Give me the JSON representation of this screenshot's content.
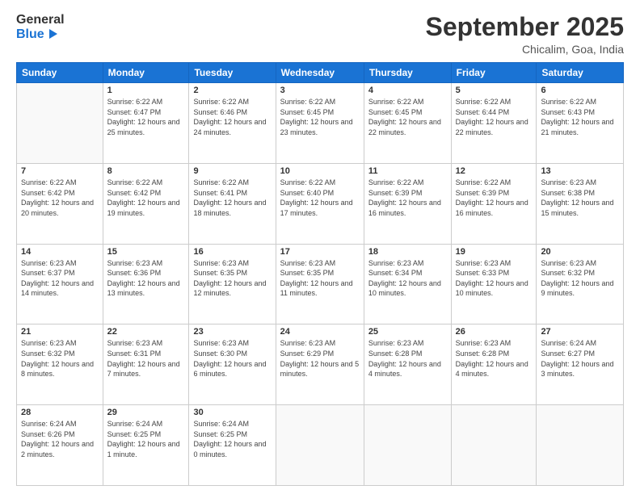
{
  "logo": {
    "line1": "General",
    "line2": "Blue"
  },
  "title": "September 2025",
  "location": "Chicalim, Goa, India",
  "weekdays": [
    "Sunday",
    "Monday",
    "Tuesday",
    "Wednesday",
    "Thursday",
    "Friday",
    "Saturday"
  ],
  "weeks": [
    [
      {
        "day": "",
        "sunrise": "",
        "sunset": "",
        "daylight": ""
      },
      {
        "day": "1",
        "sunrise": "Sunrise: 6:22 AM",
        "sunset": "Sunset: 6:47 PM",
        "daylight": "Daylight: 12 hours and 25 minutes."
      },
      {
        "day": "2",
        "sunrise": "Sunrise: 6:22 AM",
        "sunset": "Sunset: 6:46 PM",
        "daylight": "Daylight: 12 hours and 24 minutes."
      },
      {
        "day": "3",
        "sunrise": "Sunrise: 6:22 AM",
        "sunset": "Sunset: 6:45 PM",
        "daylight": "Daylight: 12 hours and 23 minutes."
      },
      {
        "day": "4",
        "sunrise": "Sunrise: 6:22 AM",
        "sunset": "Sunset: 6:45 PM",
        "daylight": "Daylight: 12 hours and 22 minutes."
      },
      {
        "day": "5",
        "sunrise": "Sunrise: 6:22 AM",
        "sunset": "Sunset: 6:44 PM",
        "daylight": "Daylight: 12 hours and 22 minutes."
      },
      {
        "day": "6",
        "sunrise": "Sunrise: 6:22 AM",
        "sunset": "Sunset: 6:43 PM",
        "daylight": "Daylight: 12 hours and 21 minutes."
      }
    ],
    [
      {
        "day": "7",
        "sunrise": "Sunrise: 6:22 AM",
        "sunset": "Sunset: 6:42 PM",
        "daylight": "Daylight: 12 hours and 20 minutes."
      },
      {
        "day": "8",
        "sunrise": "Sunrise: 6:22 AM",
        "sunset": "Sunset: 6:42 PM",
        "daylight": "Daylight: 12 hours and 19 minutes."
      },
      {
        "day": "9",
        "sunrise": "Sunrise: 6:22 AM",
        "sunset": "Sunset: 6:41 PM",
        "daylight": "Daylight: 12 hours and 18 minutes."
      },
      {
        "day": "10",
        "sunrise": "Sunrise: 6:22 AM",
        "sunset": "Sunset: 6:40 PM",
        "daylight": "Daylight: 12 hours and 17 minutes."
      },
      {
        "day": "11",
        "sunrise": "Sunrise: 6:22 AM",
        "sunset": "Sunset: 6:39 PM",
        "daylight": "Daylight: 12 hours and 16 minutes."
      },
      {
        "day": "12",
        "sunrise": "Sunrise: 6:22 AM",
        "sunset": "Sunset: 6:39 PM",
        "daylight": "Daylight: 12 hours and 16 minutes."
      },
      {
        "day": "13",
        "sunrise": "Sunrise: 6:23 AM",
        "sunset": "Sunset: 6:38 PM",
        "daylight": "Daylight: 12 hours and 15 minutes."
      }
    ],
    [
      {
        "day": "14",
        "sunrise": "Sunrise: 6:23 AM",
        "sunset": "Sunset: 6:37 PM",
        "daylight": "Daylight: 12 hours and 14 minutes."
      },
      {
        "day": "15",
        "sunrise": "Sunrise: 6:23 AM",
        "sunset": "Sunset: 6:36 PM",
        "daylight": "Daylight: 12 hours and 13 minutes."
      },
      {
        "day": "16",
        "sunrise": "Sunrise: 6:23 AM",
        "sunset": "Sunset: 6:35 PM",
        "daylight": "Daylight: 12 hours and 12 minutes."
      },
      {
        "day": "17",
        "sunrise": "Sunrise: 6:23 AM",
        "sunset": "Sunset: 6:35 PM",
        "daylight": "Daylight: 12 hours and 11 minutes."
      },
      {
        "day": "18",
        "sunrise": "Sunrise: 6:23 AM",
        "sunset": "Sunset: 6:34 PM",
        "daylight": "Daylight: 12 hours and 10 minutes."
      },
      {
        "day": "19",
        "sunrise": "Sunrise: 6:23 AM",
        "sunset": "Sunset: 6:33 PM",
        "daylight": "Daylight: 12 hours and 10 minutes."
      },
      {
        "day": "20",
        "sunrise": "Sunrise: 6:23 AM",
        "sunset": "Sunset: 6:32 PM",
        "daylight": "Daylight: 12 hours and 9 minutes."
      }
    ],
    [
      {
        "day": "21",
        "sunrise": "Sunrise: 6:23 AM",
        "sunset": "Sunset: 6:32 PM",
        "daylight": "Daylight: 12 hours and 8 minutes."
      },
      {
        "day": "22",
        "sunrise": "Sunrise: 6:23 AM",
        "sunset": "Sunset: 6:31 PM",
        "daylight": "Daylight: 12 hours and 7 minutes."
      },
      {
        "day": "23",
        "sunrise": "Sunrise: 6:23 AM",
        "sunset": "Sunset: 6:30 PM",
        "daylight": "Daylight: 12 hours and 6 minutes."
      },
      {
        "day": "24",
        "sunrise": "Sunrise: 6:23 AM",
        "sunset": "Sunset: 6:29 PM",
        "daylight": "Daylight: 12 hours and 5 minutes."
      },
      {
        "day": "25",
        "sunrise": "Sunrise: 6:23 AM",
        "sunset": "Sunset: 6:28 PM",
        "daylight": "Daylight: 12 hours and 4 minutes."
      },
      {
        "day": "26",
        "sunrise": "Sunrise: 6:23 AM",
        "sunset": "Sunset: 6:28 PM",
        "daylight": "Daylight: 12 hours and 4 minutes."
      },
      {
        "day": "27",
        "sunrise": "Sunrise: 6:24 AM",
        "sunset": "Sunset: 6:27 PM",
        "daylight": "Daylight: 12 hours and 3 minutes."
      }
    ],
    [
      {
        "day": "28",
        "sunrise": "Sunrise: 6:24 AM",
        "sunset": "Sunset: 6:26 PM",
        "daylight": "Daylight: 12 hours and 2 minutes."
      },
      {
        "day": "29",
        "sunrise": "Sunrise: 6:24 AM",
        "sunset": "Sunset: 6:25 PM",
        "daylight": "Daylight: 12 hours and 1 minute."
      },
      {
        "day": "30",
        "sunrise": "Sunrise: 6:24 AM",
        "sunset": "Sunset: 6:25 PM",
        "daylight": "Daylight: 12 hours and 0 minutes."
      },
      {
        "day": "",
        "sunrise": "",
        "sunset": "",
        "daylight": ""
      },
      {
        "day": "",
        "sunrise": "",
        "sunset": "",
        "daylight": ""
      },
      {
        "day": "",
        "sunrise": "",
        "sunset": "",
        "daylight": ""
      },
      {
        "day": "",
        "sunrise": "",
        "sunset": "",
        "daylight": ""
      }
    ]
  ]
}
